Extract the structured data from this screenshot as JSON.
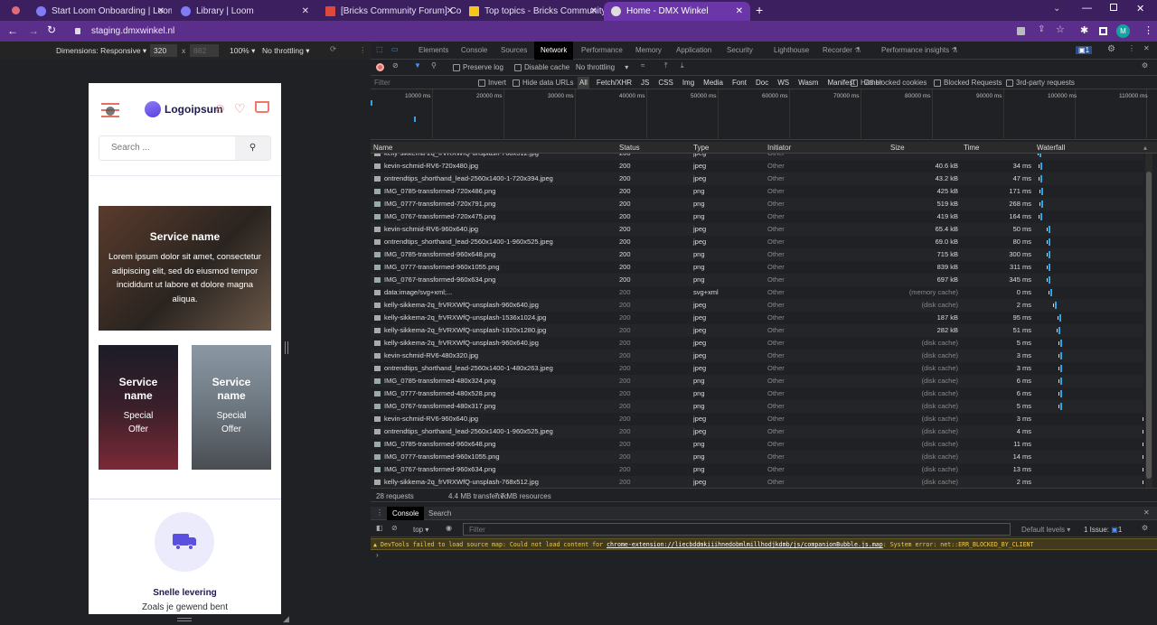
{
  "browser": {
    "tabs": [
      {
        "title": "Start Loom Onboarding | Loom",
        "icon": "loom-icon"
      },
      {
        "title": "Library | Loom",
        "icon": "loom-icon"
      },
      {
        "title": "[Bricks Community Forum] Confi",
        "icon": "gmail-icon"
      },
      {
        "title": "Top topics - Bricks Community Fo",
        "icon": "bricks-icon"
      },
      {
        "title": "Home - DMX Winkel",
        "icon": "wordpress-icon",
        "active": true
      }
    ],
    "url": "staging.dmxwinkel.nl",
    "profile_initial": "M"
  },
  "device_toolbar": {
    "dimensions": "Dimensions: Responsive",
    "width": "320",
    "height_placeholder": "882",
    "zoom": "100%",
    "throttling": "No throttling"
  },
  "devtools": {
    "tabs": [
      "Elements",
      "Console",
      "Sources",
      "Network",
      "Performance",
      "Memory",
      "Application",
      "Security",
      "Lighthouse",
      "Recorder",
      "Performance insights"
    ],
    "active_tab": "Network",
    "issues_badge": "1",
    "network_toolbar": {
      "preserve_log": "Preserve log",
      "disable_cache": "Disable cache",
      "throttling": "No throttling"
    },
    "filter_placeholder": "Filter",
    "filter_options": [
      "Invert",
      "Hide data URLs"
    ],
    "type_filters": [
      "All",
      "Fetch/XHR",
      "JS",
      "CSS",
      "Img",
      "Media",
      "Font",
      "Doc",
      "WS",
      "Wasm",
      "Manifest",
      "Other"
    ],
    "extra_filters": [
      "Has blocked cookies",
      "Blocked Requests",
      "3rd-party requests"
    ],
    "timeline_ticks": [
      "10000 ms",
      "20000 ms",
      "30000 ms",
      "40000 ms",
      "50000 ms",
      "60000 ms",
      "70000 ms",
      "80000 ms",
      "90000 ms",
      "100000 ms",
      "110000 ms"
    ],
    "columns": [
      "Name",
      "Status",
      "Type",
      "Initiator",
      "Size",
      "Time",
      "Waterfall"
    ],
    "rows": [
      {
        "name": "kelly-sikkema-2q_frVRXWfQ-unsplash-768x512.jpg",
        "status": "200",
        "type": "jpeg",
        "initiator": "Other",
        "size": "",
        "time": ""
      },
      {
        "name": "kevin-schmid-RV6-720x480.jpg",
        "status": "200",
        "type": "jpeg",
        "initiator": "Other",
        "size": "40.6 kB",
        "time": "34 ms"
      },
      {
        "name": "ontrendtips_shorthand_lead-2560x1400-1-720x394.jpeg",
        "status": "200",
        "type": "jpeg",
        "initiator": "Other",
        "size": "43.2 kB",
        "time": "47 ms"
      },
      {
        "name": "IMG_0785-transformed-720x486.png",
        "status": "200",
        "type": "png",
        "initiator": "Other",
        "size": "425 kB",
        "time": "171 ms"
      },
      {
        "name": "IMG_0777-transformed-720x791.png",
        "status": "200",
        "type": "png",
        "initiator": "Other",
        "size": "519 kB",
        "time": "268 ms"
      },
      {
        "name": "IMG_0767-transformed-720x475.png",
        "status": "200",
        "type": "png",
        "initiator": "Other",
        "size": "419 kB",
        "time": "164 ms"
      },
      {
        "name": "kevin-schmid-RV6-960x640.jpg",
        "status": "200",
        "type": "jpeg",
        "initiator": "Other",
        "size": "65.4 kB",
        "time": "50 ms"
      },
      {
        "name": "ontrendtips_shorthand_lead-2560x1400-1-960x525.jpeg",
        "status": "200",
        "type": "jpeg",
        "initiator": "Other",
        "size": "69.0 kB",
        "time": "80 ms"
      },
      {
        "name": "IMG_0785-transformed-960x648.png",
        "status": "200",
        "type": "png",
        "initiator": "Other",
        "size": "715 kB",
        "time": "300 ms"
      },
      {
        "name": "IMG_0777-transformed-960x1055.png",
        "status": "200",
        "type": "png",
        "initiator": "Other",
        "size": "839 kB",
        "time": "311 ms"
      },
      {
        "name": "IMG_0767-transformed-960x634.png",
        "status": "200",
        "type": "png",
        "initiator": "Other",
        "size": "697 kB",
        "time": "345 ms"
      },
      {
        "name": "data:image/svg+xml;...",
        "status": "200",
        "type": "svg+xml",
        "initiator": "Other",
        "size": "(memory cache)",
        "time": "0 ms"
      },
      {
        "name": "kelly-sikkema-2q_frVRXWfQ-unsplash-960x640.jpg",
        "status": "200",
        "type": "jpeg",
        "initiator": "Other",
        "size": "(disk cache)",
        "time": "2 ms"
      },
      {
        "name": "kelly-sikkema-2q_frVRXWfQ-unsplash-1536x1024.jpg",
        "status": "200",
        "type": "jpeg",
        "initiator": "Other",
        "size": "187 kB",
        "time": "95 ms"
      },
      {
        "name": "kelly-sikkema-2q_frVRXWfQ-unsplash-1920x1280.jpg",
        "status": "200",
        "type": "jpeg",
        "initiator": "Other",
        "size": "282 kB",
        "time": "51 ms"
      },
      {
        "name": "kelly-sikkema-2q_frVRXWfQ-unsplash-960x640.jpg",
        "status": "200",
        "type": "jpeg",
        "initiator": "Other",
        "size": "(disk cache)",
        "time": "5 ms"
      },
      {
        "name": "kevin-schmid-RV6-480x320.jpg",
        "status": "200",
        "type": "jpeg",
        "initiator": "Other",
        "size": "(disk cache)",
        "time": "3 ms"
      },
      {
        "name": "ontrendtips_shorthand_lead-2560x1400-1-480x263.jpeg",
        "status": "200",
        "type": "jpeg",
        "initiator": "Other",
        "size": "(disk cache)",
        "time": "3 ms"
      },
      {
        "name": "IMG_0785-transformed-480x324.png",
        "status": "200",
        "type": "png",
        "initiator": "Other",
        "size": "(disk cache)",
        "time": "6 ms"
      },
      {
        "name": "IMG_0777-transformed-480x528.png",
        "status": "200",
        "type": "png",
        "initiator": "Other",
        "size": "(disk cache)",
        "time": "6 ms"
      },
      {
        "name": "IMG_0767-transformed-480x317.png",
        "status": "200",
        "type": "png",
        "initiator": "Other",
        "size": "(disk cache)",
        "time": "5 ms"
      },
      {
        "name": "kevin-schmid-RV6-960x640.jpg",
        "status": "200",
        "type": "jpeg",
        "initiator": "Other",
        "size": "(disk cache)",
        "time": "3 ms"
      },
      {
        "name": "ontrendtips_shorthand_lead-2560x1400-1-960x525.jpeg",
        "status": "200",
        "type": "jpeg",
        "initiator": "Other",
        "size": "(disk cache)",
        "time": "4 ms"
      },
      {
        "name": "IMG_0785-transformed-960x648.png",
        "status": "200",
        "type": "png",
        "initiator": "Other",
        "size": "(disk cache)",
        "time": "11 ms"
      },
      {
        "name": "IMG_0777-transformed-960x1055.png",
        "status": "200",
        "type": "png",
        "initiator": "Other",
        "size": "(disk cache)",
        "time": "14 ms"
      },
      {
        "name": "IMG_0767-transformed-960x634.png",
        "status": "200",
        "type": "png",
        "initiator": "Other",
        "size": "(disk cache)",
        "time": "13 ms"
      },
      {
        "name": "kelly-sikkema-2q_frVRXWfQ-unsplash-768x512.jpg",
        "status": "200",
        "type": "jpeg",
        "initiator": "Other",
        "size": "(disk cache)",
        "time": "2 ms"
      }
    ],
    "summary": {
      "requests": "28 requests",
      "transferred": "4.4 MB transferred",
      "resources": "7.7 MB resources"
    },
    "drawer": {
      "tabs": [
        "Console",
        "Search"
      ],
      "context": "top",
      "filter_placeholder": "Filter",
      "levels": "Default levels",
      "issues": "1 Issue:",
      "issues_count": "1",
      "warning_prefix": "DevTools failed to load source map: Could not load content for ",
      "warning_link": "chrome-extension://liecbddmkiiihnedobmlmillhodjkdmb/js/companionBubble.js.map",
      "warning_suffix": ": System error: net::ERR_BLOCKED_BY_CLIENT",
      "prompt": "›"
    }
  },
  "site": {
    "logo": "Logoipsum",
    "search_placeholder": "Search ...",
    "hero_card": {
      "title": "Service name",
      "text": "Lorem ipsum dolor sit amet, consectetur adipiscing elit, sed do eiusmod tempor incididunt ut labore et dolore magna aliqua."
    },
    "small_cards": [
      {
        "title": "Service name",
        "text": "Special Offer"
      },
      {
        "title": "Service name",
        "text": "Special Offer"
      }
    ],
    "feature": {
      "title": "Snelle levering",
      "text": "Zoals je gewend bent"
    },
    "accent": "#5b4fe0",
    "icon_color": "#f0776c"
  }
}
